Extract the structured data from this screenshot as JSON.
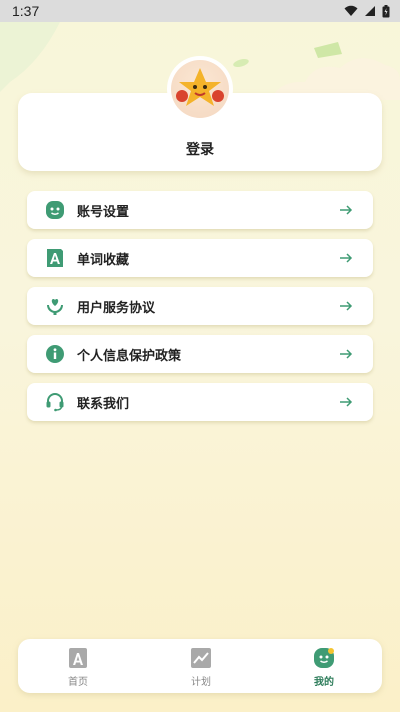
{
  "status_bar": {
    "time": "1:37"
  },
  "profile": {
    "login_label": "登录"
  },
  "menu": [
    {
      "label": "账号设置",
      "icon": "face-icon"
    },
    {
      "label": "单词收藏",
      "icon": "word-book-icon"
    },
    {
      "label": "用户服务协议",
      "icon": "hand-heart-icon"
    },
    {
      "label": "个人信息保护政策",
      "icon": "info-icon"
    },
    {
      "label": "联系我们",
      "icon": "headset-icon"
    }
  ],
  "tabs": [
    {
      "label": "首页",
      "icon": "home-word-icon",
      "active": false
    },
    {
      "label": "计划",
      "icon": "plan-chart-icon",
      "active": false
    },
    {
      "label": "我的",
      "icon": "profile-face-icon",
      "active": true
    }
  ],
  "colors": {
    "accent": "#3f9b74",
    "tab_active": "#2e7d5b"
  }
}
